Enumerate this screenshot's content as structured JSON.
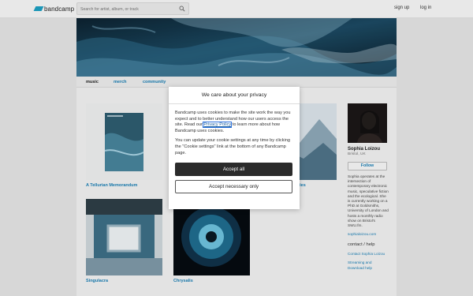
{
  "header": {
    "logo_text": "bandcamp",
    "search_placeholder": "Search for artist, album, or track",
    "signup": "sign up",
    "login": "log in"
  },
  "tabs": [
    {
      "label": "music",
      "active": true
    },
    {
      "label": "merch",
      "active": false
    },
    {
      "label": "community",
      "active": false
    }
  ],
  "albums": [
    {
      "title": "A Tellurian Memorandum"
    },
    {
      "title": "ries"
    },
    {
      "title": "Singulacra"
    },
    {
      "title": "Chrysalis"
    }
  ],
  "artist": {
    "name": "Sophia Loizou",
    "location": "Bristol, UK",
    "follow_label": "Follow",
    "bio": "Sophia operates at the intersection of contemporary electronic music, speculative fiction and the ecological. She is currently working on a PhD at Goldsmiths, University of London and hosts a monthly radio show on Bristol's SWU.fm.",
    "website": "sophialoizou.com",
    "contact_heading": "contact / help",
    "links": [
      "Contact Sophia Loizou",
      "Streaming and Download help"
    ]
  },
  "cookie_modal": {
    "title": "We care about your privacy",
    "p1_before": "Bandcamp uses cookies to make the site work the way you expect and to better understand how our users access the site. Read our ",
    "p1_link": "Privacy Policy",
    "p1_after": " to learn more about how Bandcamp uses cookies.",
    "p2": "You can update your cookie settings at any time by clicking the \"Cookie settings\" link at the bottom of any Bandcamp page.",
    "accept_all": "Accept all",
    "accept_necessary": "Accept necessary only"
  },
  "colors": {
    "accent_link": "#1a7fb5",
    "logo_blue": "#1da0c3",
    "primary_button": "#2b2b2b"
  }
}
